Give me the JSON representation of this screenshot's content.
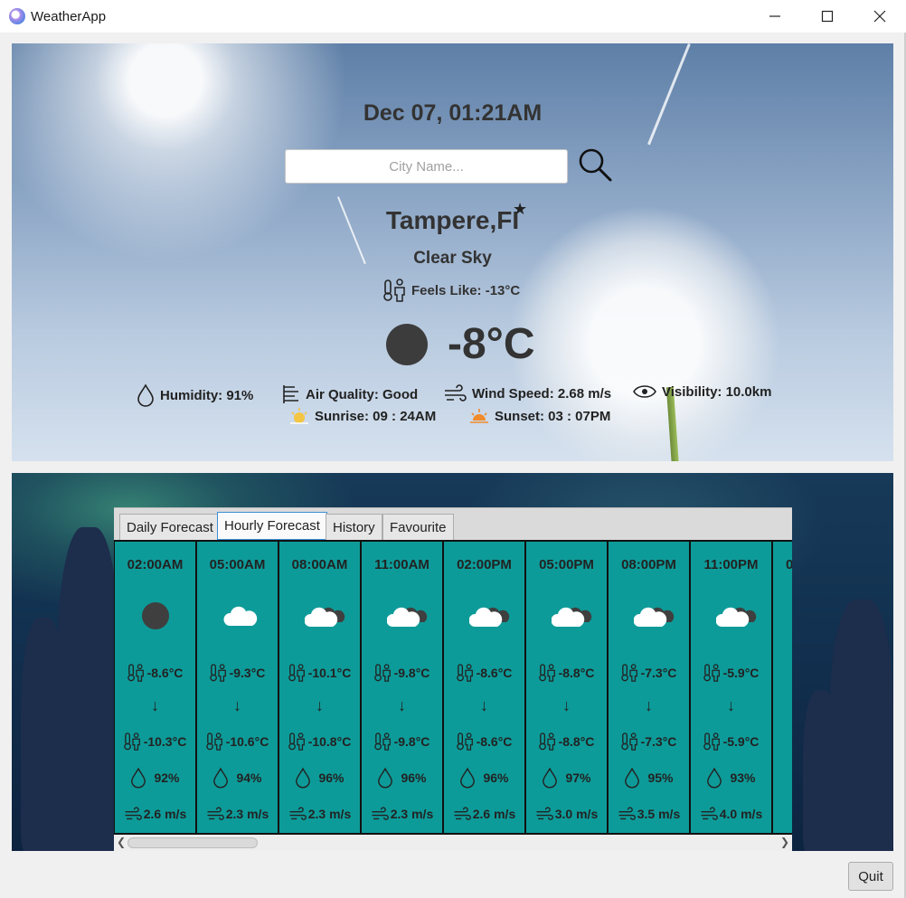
{
  "window": {
    "title": "WeatherApp",
    "minimize": "—",
    "maximize": "☐",
    "close": "✕"
  },
  "current": {
    "datetime": "Dec 07, 01:21AM",
    "search_placeholder": "City Name...",
    "city": "Tampere,FI",
    "favorite_star": "★",
    "condition": "Clear Sky",
    "feels_like": "Feels Like: -13°C",
    "temperature": "-8°C",
    "humidity": "Humidity: 91%",
    "air_quality": "Air Quality: Good",
    "wind_speed": "Wind Speed: 2.68 m/s",
    "visibility": "Visibility: 10.0km",
    "sunrise": "Sunrise:  09 : 24AM",
    "sunset": "Sunset:  03 : 07PM"
  },
  "tabs": [
    "Daily Forecast",
    "Hourly Forecast",
    "History",
    "Favourite"
  ],
  "active_tab": "Hourly Forecast",
  "hourly": [
    {
      "time": "02:00AM",
      "icon": "moon",
      "temp": "-8.6°C",
      "arrow": "↓",
      "feels": "-10.3°C",
      "humidity": "92%",
      "wind": "2.6 m/s"
    },
    {
      "time": "05:00AM",
      "icon": "cloud",
      "temp": "-9.3°C",
      "arrow": "↓",
      "feels": "-10.6°C",
      "humidity": "94%",
      "wind": "2.3 m/s"
    },
    {
      "time": "08:00AM",
      "icon": "cloud-dark",
      "temp": "-10.1°C",
      "arrow": "↓",
      "feels": "-10.8°C",
      "humidity": "96%",
      "wind": "2.3 m/s"
    },
    {
      "time": "11:00AM",
      "icon": "cloud-dark",
      "temp": "-9.8°C",
      "arrow": "↓",
      "feels": "-9.8°C",
      "humidity": "96%",
      "wind": "2.3 m/s"
    },
    {
      "time": "02:00PM",
      "icon": "cloud-dark",
      "temp": "-8.6°C",
      "arrow": "↓",
      "feels": "-8.6°C",
      "humidity": "96%",
      "wind": "2.6 m/s"
    },
    {
      "time": "05:00PM",
      "icon": "cloud-dark",
      "temp": "-8.8°C",
      "arrow": "↓",
      "feels": "-8.8°C",
      "humidity": "97%",
      "wind": "3.0 m/s"
    },
    {
      "time": "08:00PM",
      "icon": "cloud-dark",
      "temp": "-7.3°C",
      "arrow": "↓",
      "feels": "-7.3°C",
      "humidity": "95%",
      "wind": "3.5 m/s"
    },
    {
      "time": "11:00PM",
      "icon": "cloud-dark",
      "temp": "-5.9°C",
      "arrow": "↓",
      "feels": "-5.9°C",
      "humidity": "93%",
      "wind": "4.0 m/s"
    },
    {
      "time": "0",
      "icon": "none",
      "temp": "",
      "arrow": "",
      "feels": "",
      "humidity": "",
      "wind": ""
    }
  ],
  "quit_label": "Quit",
  "colors": {
    "card": "#0d9b99",
    "tab_active_border": "#3d8fd6"
  }
}
